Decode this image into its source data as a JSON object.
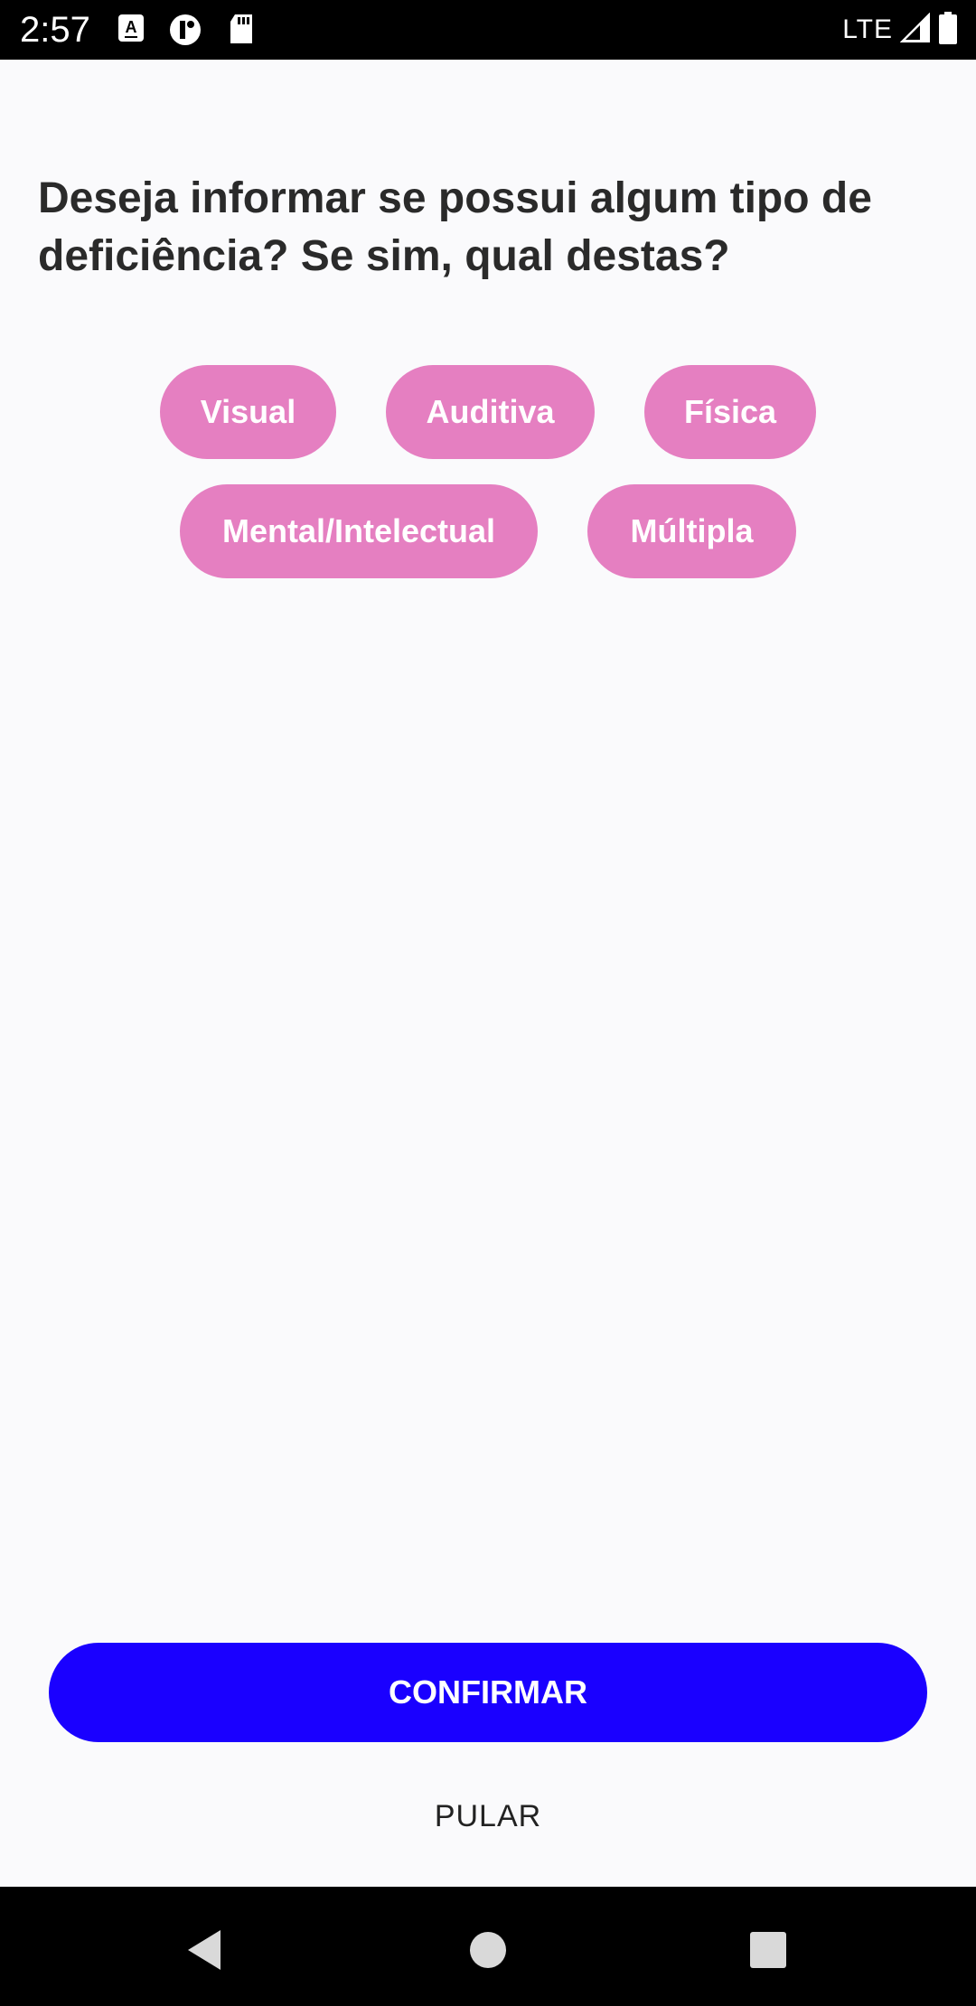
{
  "status_bar": {
    "time": "2:57",
    "network": "LTE",
    "icons": [
      "a-accessibility-icon",
      "notification-app-icon",
      "sd-card-icon",
      "signal-icon",
      "battery-icon"
    ]
  },
  "question": {
    "text": "Deseja informar se possui algum tipo de deficiência? Se sim, qual destas?"
  },
  "options": [
    {
      "label": "Visual"
    },
    {
      "label": "Auditiva"
    },
    {
      "label": "Física"
    },
    {
      "label": "Mental/Intelectual"
    },
    {
      "label": "Múltipla"
    }
  ],
  "actions": {
    "confirm_label": "CONFIRMAR",
    "skip_label": "PULAR"
  },
  "colors": {
    "chip": "#e57fc1",
    "primary": "#1a00ff",
    "background": "#fafafc"
  },
  "nav_bar": {
    "buttons": [
      "back-icon",
      "home-icon",
      "recents-icon"
    ]
  }
}
